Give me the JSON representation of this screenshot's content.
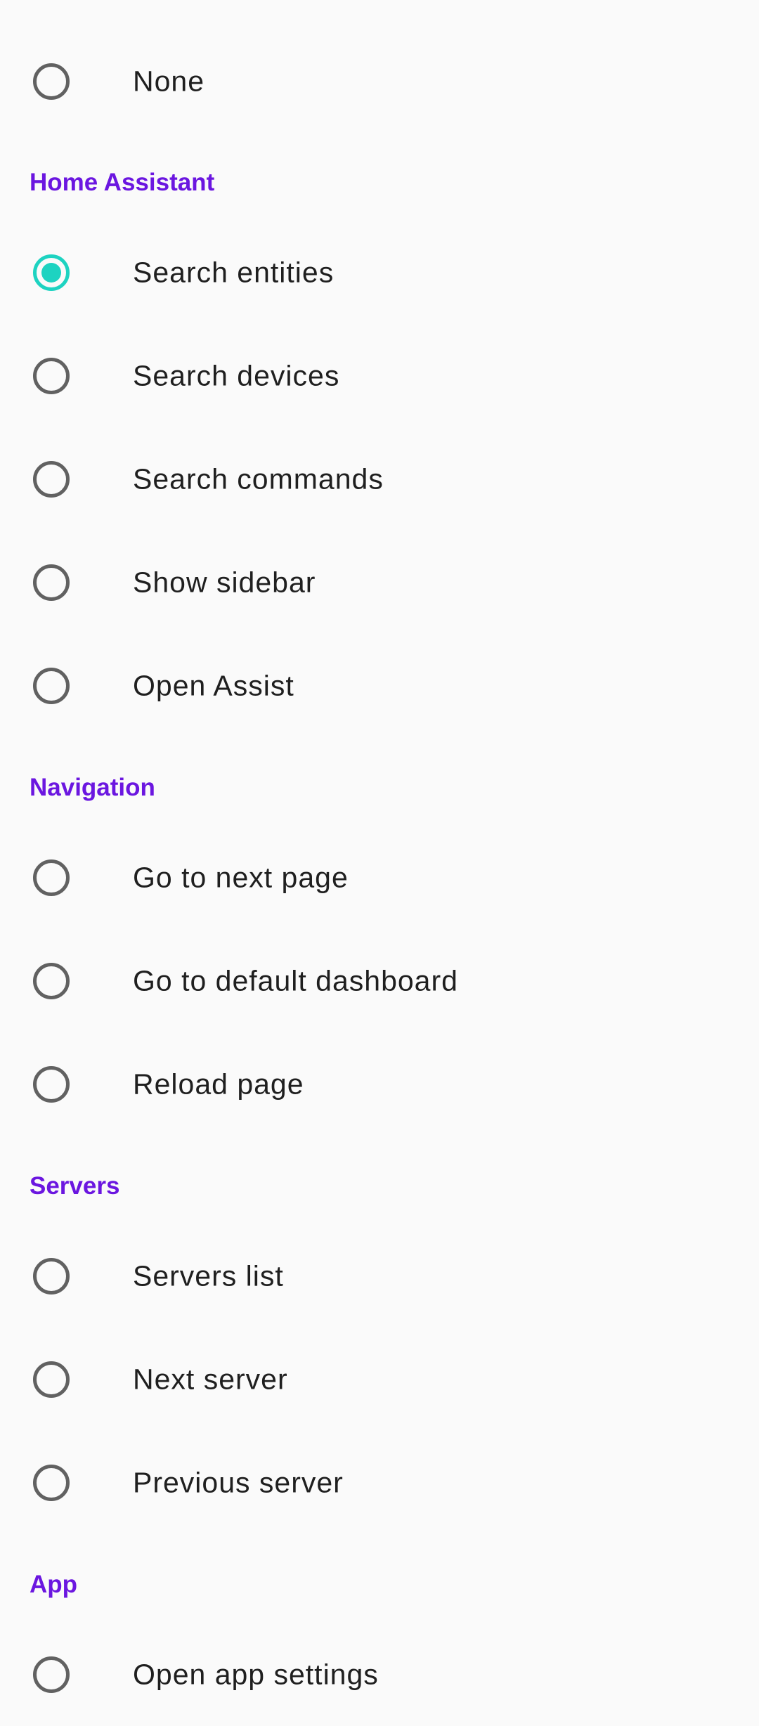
{
  "options": {
    "none": "None"
  },
  "sections": {
    "home_assistant": {
      "title": "Home Assistant",
      "items": [
        "Search entities",
        "Search devices",
        "Search commands",
        "Show sidebar",
        "Open Assist"
      ],
      "selected": "Search entities"
    },
    "navigation": {
      "title": "Navigation",
      "items": [
        "Go to next page",
        "Go to default dashboard",
        "Reload page"
      ]
    },
    "servers": {
      "title": "Servers",
      "items": [
        "Servers list",
        "Next server",
        "Previous server"
      ]
    },
    "app": {
      "title": "App",
      "items": [
        "Open app settings"
      ]
    }
  },
  "colors": {
    "accent_header": "#6b16e0",
    "radio_selected": "#1dd3c1",
    "radio_unselected": "#616161",
    "background": "#fafafa",
    "text": "#1f1f1f"
  }
}
